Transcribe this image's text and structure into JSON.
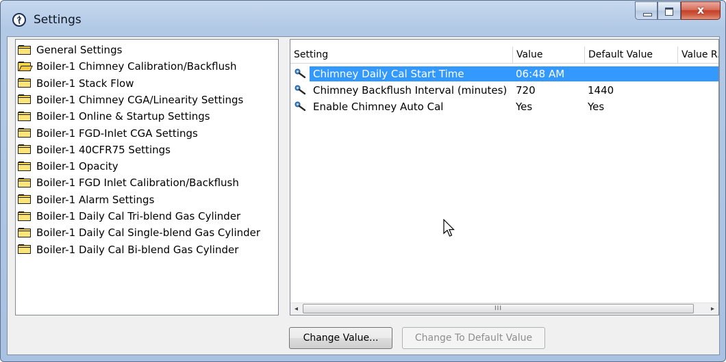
{
  "window": {
    "title": "Settings",
    "close_glyph": "x",
    "icons": {
      "app": "app-logo-icon",
      "minimize": "minimize-icon",
      "maximize": "maximize-icon",
      "close": "close-icon"
    }
  },
  "tree": {
    "items": [
      {
        "label": "General Settings",
        "open": false
      },
      {
        "label": "Boiler-1 Chimney Calibration/Backflush",
        "open": true
      },
      {
        "label": "Boiler-1 Stack Flow",
        "open": false
      },
      {
        "label": "Boiler-1 Chimney CGA/Linearity Settings",
        "open": false
      },
      {
        "label": "Boiler-1 Online & Startup Settings",
        "open": false
      },
      {
        "label": "Boiler-1 FGD-Inlet CGA Settings",
        "open": false
      },
      {
        "label": "Boiler-1 40CFR75 Settings",
        "open": false
      },
      {
        "label": "Boiler-1 Opacity",
        "open": false
      },
      {
        "label": "Boiler-1 FGD Inlet Calibration/Backflush",
        "open": false
      },
      {
        "label": "Boiler-1 Alarm Settings",
        "open": false
      },
      {
        "label": "Boiler-1 Daily Cal Tri-blend Gas Cylinder",
        "open": false
      },
      {
        "label": "Boiler-1 Daily Cal Single-blend Gas Cylinder",
        "open": false
      },
      {
        "label": "Boiler-1 Daily Cal Bi-blend Gas Cylinder",
        "open": false
      }
    ]
  },
  "list": {
    "columns": [
      "Setting",
      "Value",
      "Default Value",
      "Value R..."
    ],
    "rows": [
      {
        "setting": "Chimney Daily Cal Start Time",
        "value": "06:48 AM",
        "default": "",
        "selected": true
      },
      {
        "setting": "Chimney Backflush Interval (minutes)",
        "value": "720",
        "default": "1440",
        "selected": false
      },
      {
        "setting": "Enable Chimney Auto Cal",
        "value": "Yes",
        "default": "Yes",
        "selected": false
      }
    ],
    "row_icon": "wrench-icon",
    "scrollbar": {
      "left_arrow": "◂",
      "right_arrow": "▸",
      "grip": "III"
    }
  },
  "buttons": {
    "change_value": "Change Value...",
    "change_default": "Change To Default Value"
  },
  "colors": {
    "selection": "#3399ff",
    "close_button": "#c4402a"
  }
}
